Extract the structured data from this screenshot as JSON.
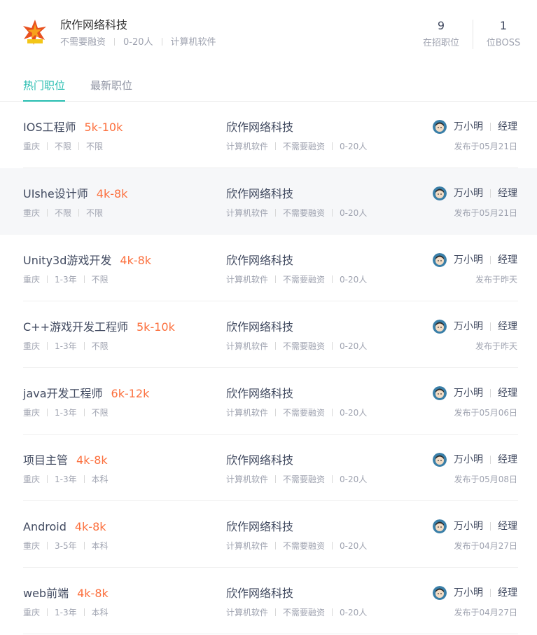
{
  "company": {
    "name": "欣作网络科技",
    "tags": [
      "不需要融资",
      "0-20人",
      "计算机软件"
    ],
    "stats": {
      "jobs_count": "9",
      "jobs_label": "在招职位",
      "boss_count": "1",
      "boss_label": "位BOSS"
    }
  },
  "tabs": {
    "hot": "热门职位",
    "new": "最新职位"
  },
  "colors": {
    "accent": "#26bdb0",
    "salary": "#fc703e",
    "muted": "#9fa3b0"
  },
  "jobs": [
    {
      "title": "IOS工程师",
      "salary": "5k-10k",
      "city": "重庆",
      "exp": "不限",
      "edu": "不限",
      "company": "欣作网络科技",
      "industry": "计算机软件",
      "funding": "不需要融资",
      "size": "0-20人",
      "recruiter": "万小明",
      "role": "经理",
      "published": "发布于05月21日"
    },
    {
      "title": "UIshe设计师",
      "salary": "4k-8k",
      "city": "重庆",
      "exp": "不限",
      "edu": "不限",
      "company": "欣作网络科技",
      "industry": "计算机软件",
      "funding": "不需要融资",
      "size": "0-20人",
      "recruiter": "万小明",
      "role": "经理",
      "published": "发布于05月21日"
    },
    {
      "title": "Unity3d游戏开发",
      "salary": "4k-8k",
      "city": "重庆",
      "exp": "1-3年",
      "edu": "不限",
      "company": "欣作网络科技",
      "industry": "计算机软件",
      "funding": "不需要融资",
      "size": "0-20人",
      "recruiter": "万小明",
      "role": "经理",
      "published": "发布于昨天"
    },
    {
      "title": "C++游戏开发工程师",
      "salary": "5k-10k",
      "city": "重庆",
      "exp": "1-3年",
      "edu": "不限",
      "company": "欣作网络科技",
      "industry": "计算机软件",
      "funding": "不需要融资",
      "size": "0-20人",
      "recruiter": "万小明",
      "role": "经理",
      "published": "发布于昨天"
    },
    {
      "title": "java开发工程师",
      "salary": "6k-12k",
      "city": "重庆",
      "exp": "1-3年",
      "edu": "不限",
      "company": "欣作网络科技",
      "industry": "计算机软件",
      "funding": "不需要融资",
      "size": "0-20人",
      "recruiter": "万小明",
      "role": "经理",
      "published": "发布于05月06日"
    },
    {
      "title": "项目主管",
      "salary": "4k-8k",
      "city": "重庆",
      "exp": "1-3年",
      "edu": "本科",
      "company": "欣作网络科技",
      "industry": "计算机软件",
      "funding": "不需要融资",
      "size": "0-20人",
      "recruiter": "万小明",
      "role": "经理",
      "published": "发布于05月08日"
    },
    {
      "title": "Android",
      "salary": "4k-8k",
      "city": "重庆",
      "exp": "3-5年",
      "edu": "本科",
      "company": "欣作网络科技",
      "industry": "计算机软件",
      "funding": "不需要融资",
      "size": "0-20人",
      "recruiter": "万小明",
      "role": "经理",
      "published": "发布于04月27日"
    },
    {
      "title": "web前端",
      "salary": "4k-8k",
      "city": "重庆",
      "exp": "1-3年",
      "edu": "本科",
      "company": "欣作网络科技",
      "industry": "计算机软件",
      "funding": "不需要融资",
      "size": "0-20人",
      "recruiter": "万小明",
      "role": "经理",
      "published": "发布于04月27日"
    }
  ]
}
